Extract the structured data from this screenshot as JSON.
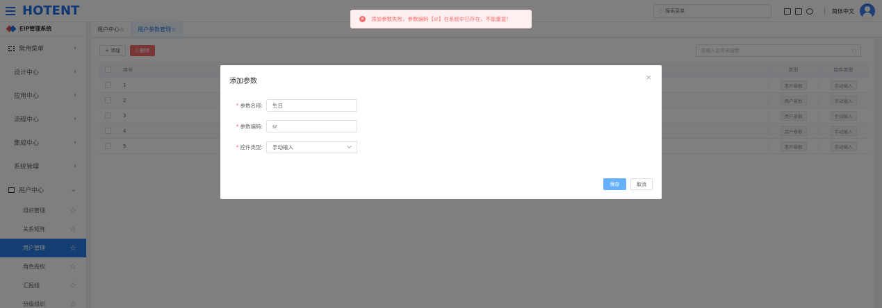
{
  "app": {
    "logo": "HOTENT",
    "system": "EIP管理系统"
  },
  "topbar": {
    "search_placeholder": "搜索菜单",
    "language": "简体中文"
  },
  "sidebar": {
    "items": [
      {
        "label": "常用菜单"
      },
      {
        "label": "设计中心"
      },
      {
        "label": "应用中心"
      },
      {
        "label": "流程中心"
      },
      {
        "label": "集成中心"
      },
      {
        "label": "系统管理"
      },
      {
        "label": "用户中心"
      }
    ],
    "sub": [
      {
        "label": "组织管理"
      },
      {
        "label": "关系矩阵"
      },
      {
        "label": "用户管理"
      },
      {
        "label": "角色授权"
      },
      {
        "label": "汇报线"
      },
      {
        "label": "分级组织"
      }
    ]
  },
  "tabs": [
    {
      "label": "用户中心"
    },
    {
      "label": "用户参数管理"
    }
  ],
  "toolbar": {
    "add": "+ 添加",
    "delete": "删除",
    "search_placeholder": "请输入名称来搜索"
  },
  "table": {
    "headers": {
      "idx": "序号",
      "type": "类型",
      "control": "控件类型"
    },
    "rows": [
      {
        "idx": "1",
        "type": "用户参数",
        "control": "手动输入"
      },
      {
        "idx": "2",
        "type": "用户参数",
        "control": "手动输入"
      },
      {
        "idx": "3",
        "type": "用户参数",
        "control": "手动输入"
      },
      {
        "idx": "4",
        "type": "用户参数",
        "control": "手动输入"
      },
      {
        "idx": "5",
        "type": "用户参数",
        "control": "手动输入"
      }
    ]
  },
  "dialog": {
    "title": "添加参数",
    "name_label": "参数名称:",
    "name_value": "生日",
    "code_label": "参数编码:",
    "code_value": "sr",
    "ctl_label": "控件类型:",
    "ctl_value": "手动输入",
    "save": "保存",
    "cancel": "取消"
  },
  "toast": {
    "message": "添加参数失败，参数编码【sr】在系统中已存在，不能重复!"
  }
}
